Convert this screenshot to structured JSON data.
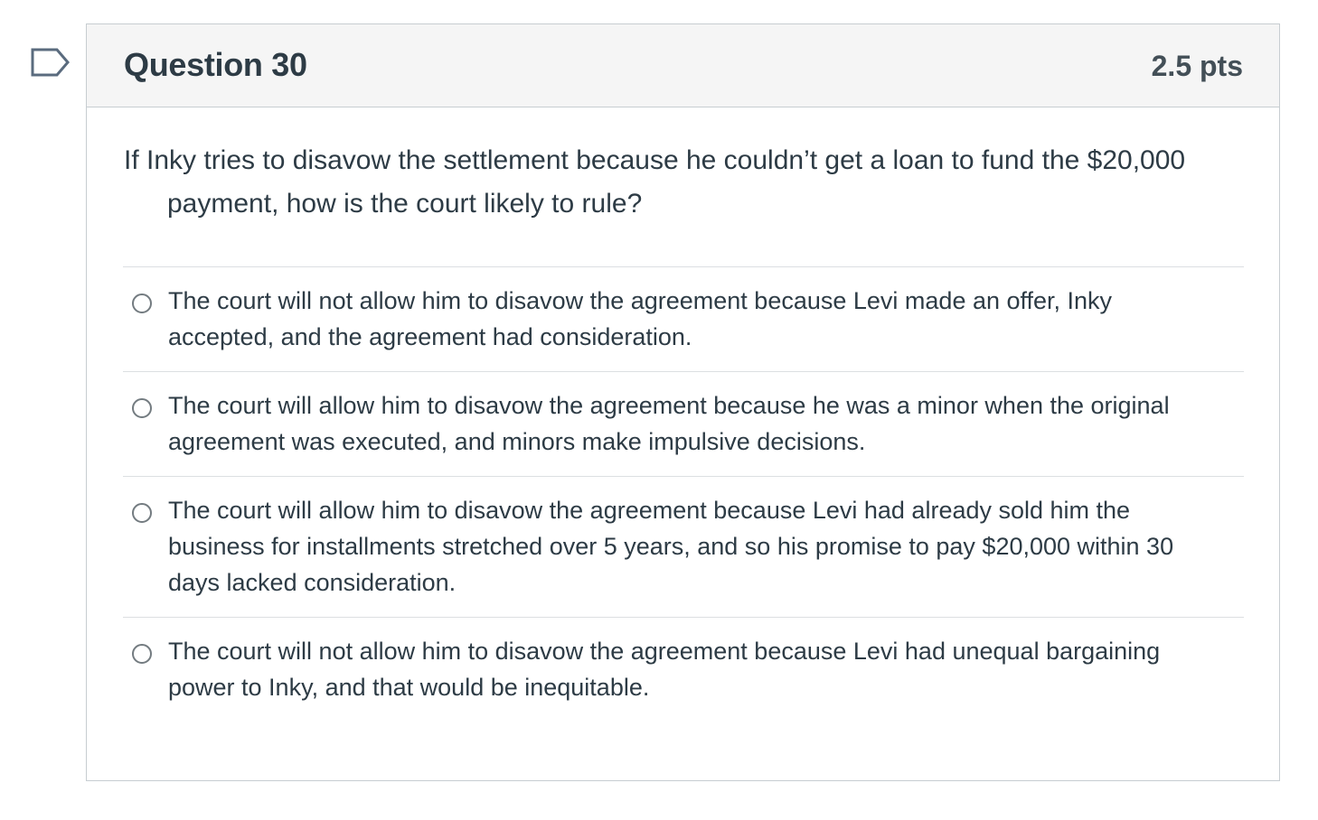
{
  "flag": {
    "icon": "flag-bookmark-icon",
    "color": "#5a6b7e"
  },
  "question": {
    "title": "Question 30",
    "points": "2.5 pts",
    "text": "If Inky tries to disavow the settlement because he couldn’t get a loan to fund the $20,000 payment, how is the court likely to rule?"
  },
  "answers": [
    {
      "label": "The court will not allow him to disavow the agreement because Levi made an offer, Inky accepted, and the agreement had consideration.",
      "selected": false
    },
    {
      "label": "The court will allow him to disavow the agreement because he was a minor when the original agreement was executed, and minors make impulsive decisions.",
      "selected": false
    },
    {
      "label": "The court will allow him to disavow the agreement because Levi had already sold him the business for installments stretched over 5 years, and so his promise to pay $20,000 within 30 days lacked consideration.",
      "selected": false
    },
    {
      "label": "The court will not allow him to disavow the agreement because Levi had unequal bargaining power to Inky, and that would be inequitable.",
      "selected": false
    }
  ],
  "colors": {
    "text": "#2d3b45",
    "header_bg": "#f5f5f5",
    "border": "#c7cdd1",
    "radio": "#737b80"
  }
}
